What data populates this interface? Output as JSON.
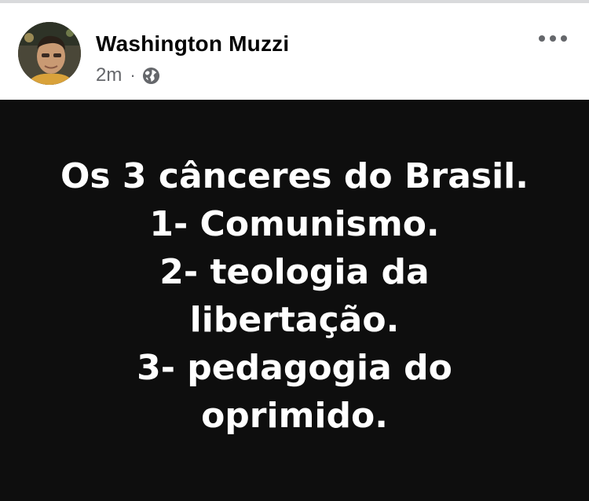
{
  "post": {
    "author": "Washington Muzzi",
    "time": "2m",
    "separator": "·",
    "audience_icon": "globe-icon",
    "more_icon": "more-options-icon",
    "text_lines": [
      "Os 3 cânceres do Brasil.",
      "1- Comunismo.",
      "2- teologia da",
      "libertação.",
      "3- pedagogia do",
      "oprimido."
    ]
  },
  "colors": {
    "background_post": "#0e0e0e",
    "text_post": "#ffffff",
    "author": "#050505",
    "meta": "#65676b"
  }
}
